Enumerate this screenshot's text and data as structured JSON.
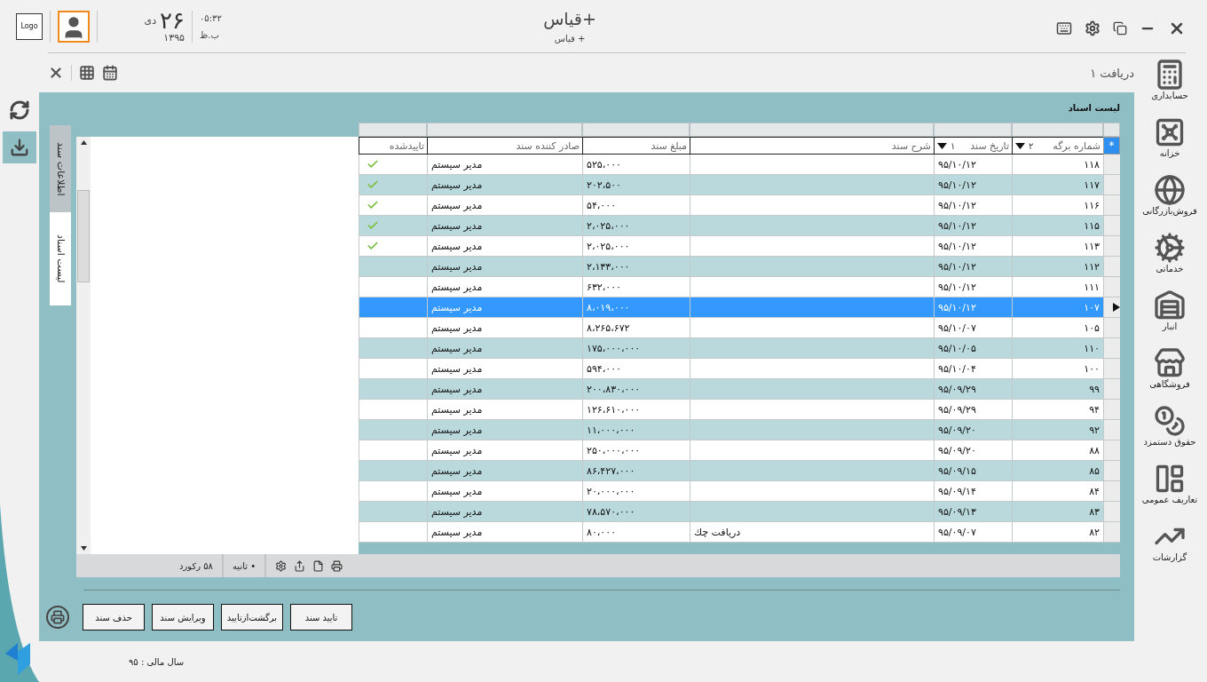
{
  "header": {
    "logo": "Logo",
    "day": "۲۶",
    "month": "دی",
    "year": "۱۳۹۵",
    "time": "۰۵:۳۲",
    "meridiem": "ب.ظ",
    "title": "قیاس+",
    "subtitle": "قیاس +"
  },
  "page_tab": "دریافت ۱",
  "left_tools": [
    {
      "kind": "refresh",
      "selected": false
    },
    {
      "kind": "download",
      "selected": true
    }
  ],
  "nav": [
    {
      "label": "حسابداری",
      "kind": "accounting"
    },
    {
      "label": "خزانه",
      "kind": "treasury"
    },
    {
      "label": "فروش‌بازرگانی",
      "kind": "commerce"
    },
    {
      "label": "خدماتی",
      "kind": "services"
    },
    {
      "label": "انبار",
      "kind": "warehouse"
    },
    {
      "label": "فروشگاهی",
      "kind": "store"
    },
    {
      "label": "حقوق دستمزد",
      "kind": "salary"
    },
    {
      "label": "تعاریف عمومی",
      "kind": "definitions"
    },
    {
      "label": "گزارشات",
      "kind": "reports"
    }
  ],
  "panel_title": "لیست اسناد",
  "side_tabs": [
    {
      "label": "اطلاعات سند",
      "selected": false
    },
    {
      "label": "لیست اسناد",
      "selected": true
    }
  ],
  "table": {
    "corner": "*",
    "columns": [
      {
        "label": "شماره برگه",
        "sort": "۲"
      },
      {
        "label": "تاریخ سند",
        "sort": "۱"
      },
      {
        "label": "شرح سند"
      },
      {
        "label": "مبلغ سند"
      },
      {
        "label": "صادر کننده سند"
      },
      {
        "label": "تاییدشده"
      }
    ],
    "rows": [
      {
        "number": "۱۱۸",
        "date": "۹۵/۱۰/۱۲",
        "amount": "۵۲۵،۰۰۰",
        "issuer": "مدیر سیستم",
        "approved": true,
        "selected": false
      },
      {
        "number": "۱۱۷",
        "date": "۹۵/۱۰/۱۲",
        "amount": "۲۰۲،۵۰۰",
        "issuer": "مدیر سیستم",
        "approved": true,
        "selected": false
      },
      {
        "number": "۱۱۶",
        "date": "۹۵/۱۰/۱۲",
        "amount": "۵۴،۰۰۰",
        "issuer": "مدیر سیستم",
        "approved": true,
        "selected": false
      },
      {
        "number": "۱۱۵",
        "date": "۹۵/۱۰/۱۲",
        "amount": "۲،۰۲۵،۰۰۰",
        "issuer": "مدیر سیستم",
        "approved": true,
        "selected": false
      },
      {
        "number": "۱۱۳",
        "date": "۹۵/۱۰/۱۲",
        "amount": "۲،۰۲۵،۰۰۰",
        "issuer": "مدیر سیستم",
        "approved": true,
        "selected": false
      },
      {
        "number": "۱۱۲",
        "date": "۹۵/۱۰/۱۲",
        "amount": "۲،۱۳۳،۰۰۰",
        "issuer": "مدیر سیستم",
        "approved": false,
        "selected": false
      },
      {
        "number": "۱۱۱",
        "date": "۹۵/۱۰/۱۲",
        "amount": "۶۳۲،۰۰۰",
        "issuer": "مدیر سیستم",
        "approved": false,
        "selected": false
      },
      {
        "number": "۱۰۷",
        "date": "۹۵/۱۰/۱۲",
        "amount": "۸،۰۱۹،۰۰۰",
        "issuer": "مدیر سیستم",
        "approved": false,
        "selected": true
      },
      {
        "number": "۱۰۵",
        "date": "۹۵/۱۰/۰۷",
        "amount": "۸،۲۶۵،۶۷۲",
        "issuer": "مدیر سیستم",
        "approved": false,
        "selected": false
      },
      {
        "number": "۱۱۰",
        "date": "۹۵/۱۰/۰۵",
        "amount": "۱۷۵،۰۰۰،۰۰۰",
        "issuer": "مدیر سیستم",
        "approved": false,
        "selected": false
      },
      {
        "number": "۱۰۰",
        "date": "۹۵/۱۰/۰۴",
        "amount": "۵۹۴،۰۰۰",
        "issuer": "مدیر سیستم",
        "approved": false,
        "selected": false
      },
      {
        "number": "۹۹",
        "date": "۹۵/۰۹/۲۹",
        "amount": "۲۰۰،۸۳۰،۰۰۰",
        "issuer": "مدیر سیستم",
        "approved": false,
        "selected": false
      },
      {
        "number": "۹۴",
        "date": "۹۵/۰۹/۲۹",
        "amount": "۱۲۶،۶۱۰،۰۰۰",
        "issuer": "مدیر سیستم",
        "approved": false,
        "selected": false
      },
      {
        "number": "۹۲",
        "date": "۹۵/۰۹/۲۰",
        "amount": "۱۱،۰۰۰،۰۰۰",
        "issuer": "مدیر سیستم",
        "approved": false,
        "selected": false
      },
      {
        "number": "۸۸",
        "date": "۹۵/۰۹/۲۰",
        "amount": "۲۵۰،۰۰۰،۰۰۰",
        "issuer": "مدیر سیستم",
        "approved": false,
        "selected": false
      },
      {
        "number": "۸۵",
        "date": "۹۵/۰۹/۱۵",
        "amount": "۸۶،۴۲۷،۰۰۰",
        "issuer": "مدیر سیستم",
        "approved": false,
        "selected": false
      },
      {
        "number": "۸۴",
        "date": "۹۵/۰۹/۱۴",
        "amount": "۲۰،۰۰۰،۰۰۰",
        "issuer": "مدیر سیستم",
        "approved": false,
        "selected": false
      },
      {
        "number": "۸۳",
        "date": "۹۵/۰۹/۱۳",
        "amount": "۷۸،۵۷۰،۰۰۰",
        "issuer": "مدیر سیستم",
        "approved": false,
        "selected": false
      },
      {
        "number": "۸۲",
        "date": "۹۵/۰۹/۰۷",
        "description": "دریافت چك",
        "amount": "۸۰،۰۰۰",
        "issuer": "مدیر سیستم",
        "approved": false,
        "selected": false
      }
    ]
  },
  "footer": {
    "records": "۵۸ رکورد",
    "timer": "• ثانیه"
  },
  "buttons": [
    "تایید سند",
    "برگشت‌ازتایید",
    "ویرایش سند",
    "حذف سند"
  ],
  "status": "سال مالی : ۹۵"
}
